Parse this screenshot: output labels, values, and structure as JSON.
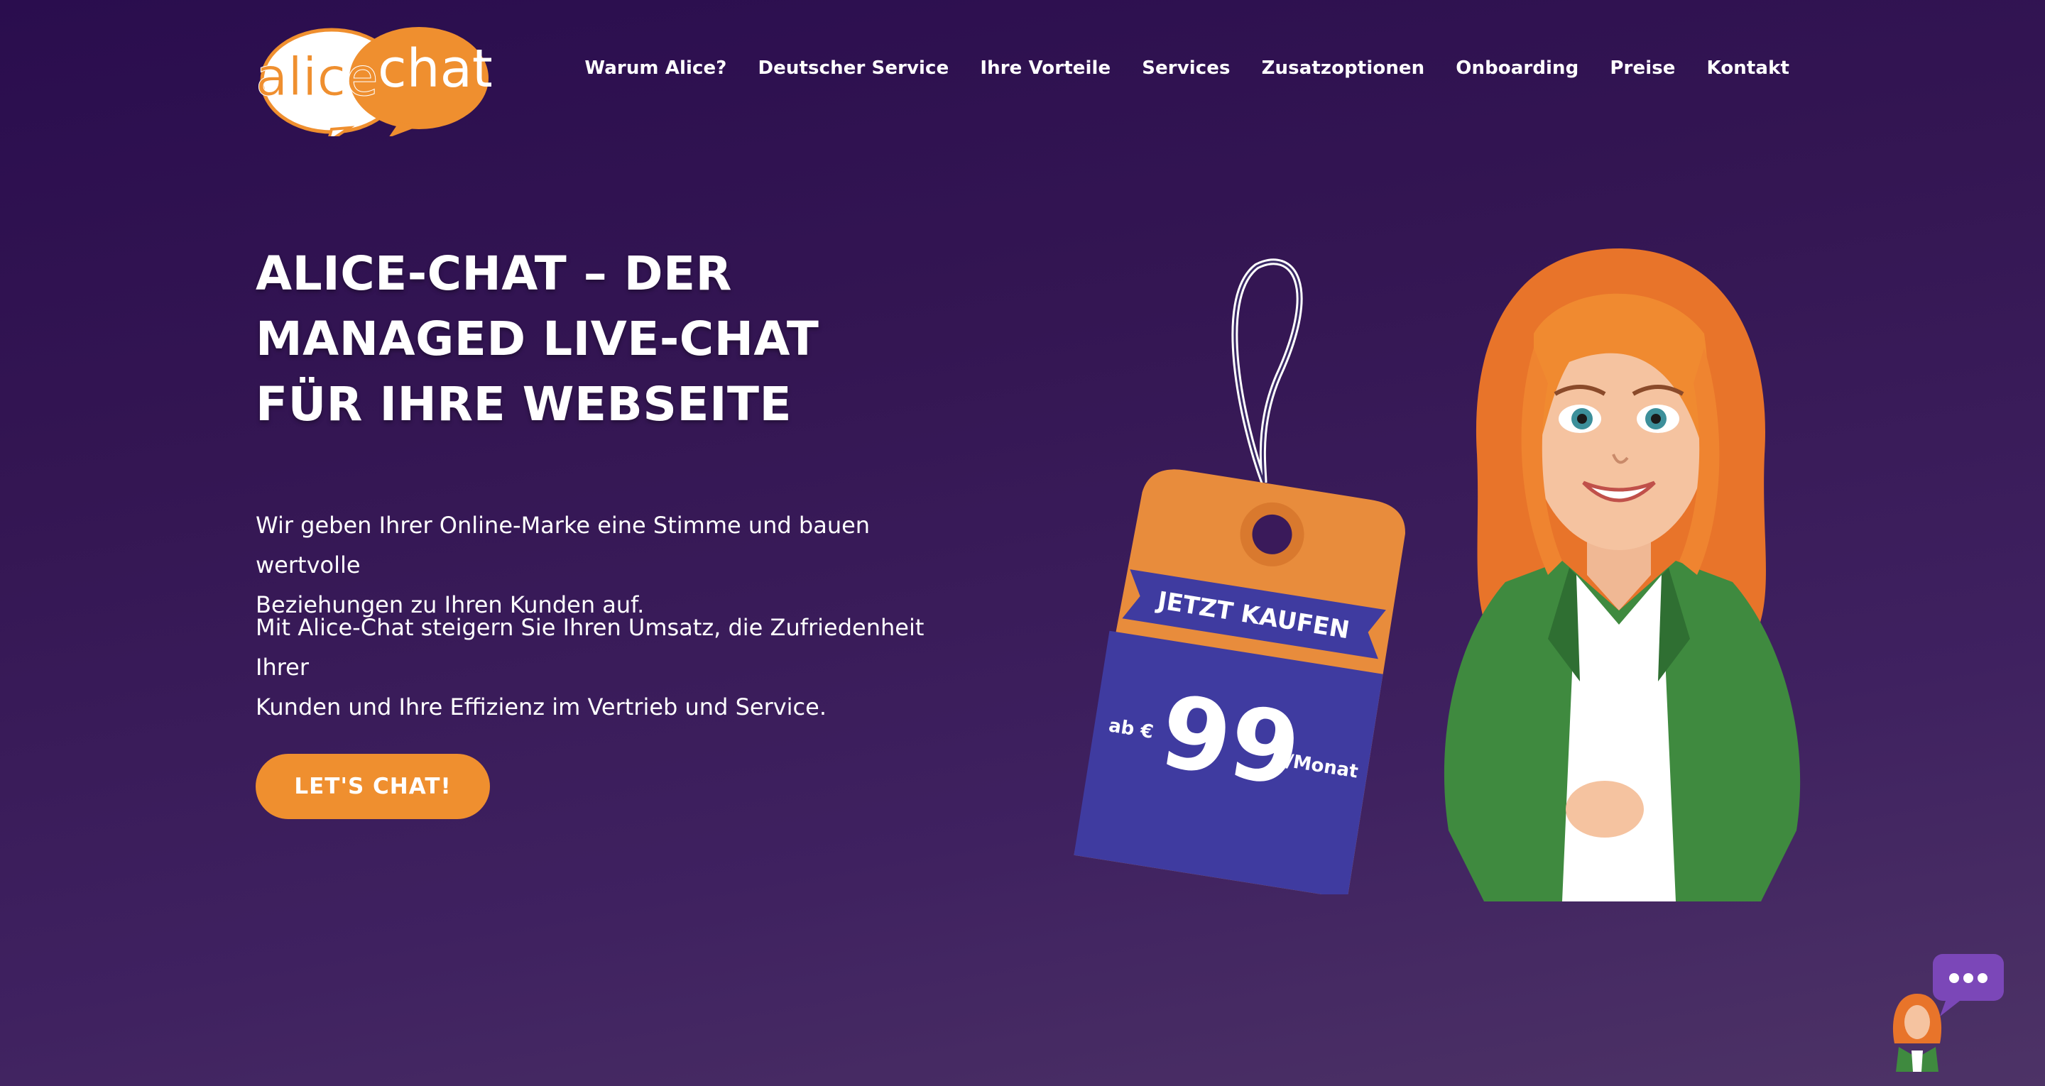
{
  "logo": {
    "word1": "alice",
    "word2": "chat"
  },
  "nav": {
    "items": [
      "Warum Alice?",
      "Deutscher Service",
      "Ihre Vorteile",
      "Services",
      "Zusatzoptionen",
      "Onboarding",
      "Preise",
      "Kontakt"
    ]
  },
  "hero": {
    "title_lines": [
      "ALICE-CHAT – DER",
      "MANAGED LIVE-CHAT",
      "FÜR IHRE WEBSEITE"
    ],
    "paragraph1_line1": "Wir geben Ihrer Online-Marke eine Stimme und bauen wertvolle",
    "paragraph1_line2": "Beziehungen zu Ihren Kunden auf.",
    "paragraph2_line1": "Mit Alice-Chat steigern Sie Ihren Umsatz, die Zufriedenheit Ihrer",
    "paragraph2_line2": "Kunden und Ihre Effizienz im Vertrieb und Service.",
    "cta_label": "LET'S CHAT!"
  },
  "price_tag": {
    "banner": "JETZT KAUFEN",
    "prefix": "ab €",
    "price": "99",
    "suffix": "/Monat"
  },
  "icons": [
    "chat-bubble-icon",
    "assistant-avatar"
  ],
  "colors": {
    "accent": "#ef8f2f",
    "tag_blue": "#3f3ba0",
    "background": "#341653"
  }
}
